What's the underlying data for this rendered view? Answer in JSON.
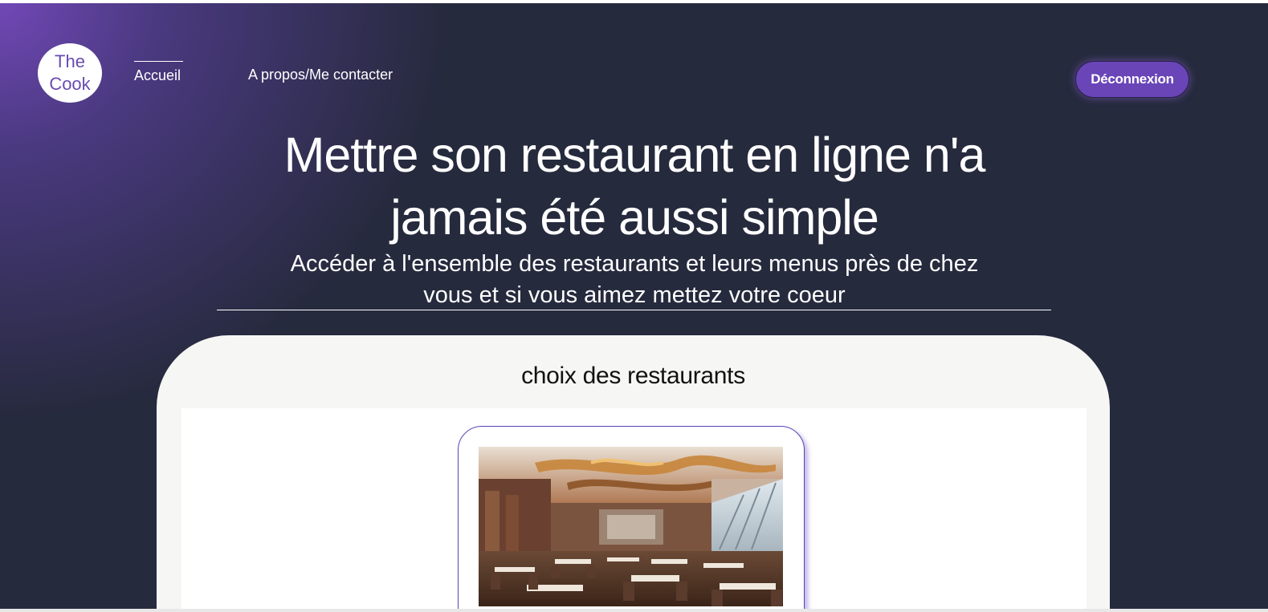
{
  "header": {
    "logo": {
      "line1": "The",
      "line2": "Cook"
    },
    "nav": {
      "home_label": "Accueil",
      "about_label": "A propos/Me contacter"
    },
    "logout_label": "Déconnexion"
  },
  "hero": {
    "title_line1": "Mettre son restaurant en ligne n'a",
    "title_line2": "jamais été aussi simple",
    "subtitle_line1": "Accéder à l'ensemble des restaurants et leurs menus près de chez",
    "subtitle_line2": "vous et si vous aimez mettez votre coeur"
  },
  "restaurants": {
    "title": "choix des restaurants",
    "cards": [
      {
        "image": "restaurant-dining-room-photo"
      }
    ]
  },
  "colors": {
    "background": "#262a3d",
    "accent": "#6a45b8",
    "panel": "#f6f6f4"
  }
}
